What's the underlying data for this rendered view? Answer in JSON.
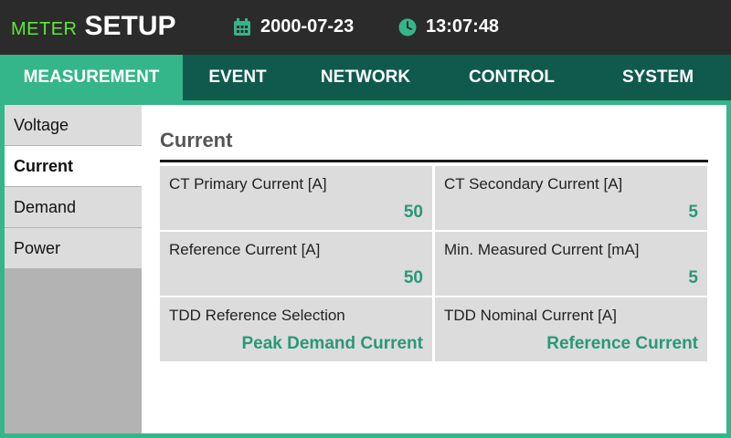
{
  "header": {
    "brand_prefix": "METER",
    "brand_title": "SETUP",
    "date": "2000-07-23",
    "time": "13:07:48",
    "date_icon": "calendar-icon",
    "time_icon": "clock-icon"
  },
  "tabs": [
    {
      "label": "MEASUREMENT",
      "active": true
    },
    {
      "label": "EVENT",
      "active": false
    },
    {
      "label": "NETWORK",
      "active": false
    },
    {
      "label": "CONTROL",
      "active": false
    },
    {
      "label": "SYSTEM",
      "active": false
    }
  ],
  "sidebar": {
    "items": [
      {
        "label": "Voltage",
        "active": false
      },
      {
        "label": "Current",
        "active": true
      },
      {
        "label": "Demand",
        "active": false
      },
      {
        "label": "Power",
        "active": false
      }
    ]
  },
  "main": {
    "title": "Current",
    "fields": [
      {
        "label": "CT Primary Current [A]",
        "value": "50"
      },
      {
        "label": "CT Secondary Current [A]",
        "value": "5"
      },
      {
        "label": "Reference Current [A]",
        "value": "50"
      },
      {
        "label": "Min. Measured Current [mA]",
        "value": "5"
      },
      {
        "label": "TDD Reference Selection",
        "value": "Peak Demand Current"
      },
      {
        "label": "TDD Nominal Current [A]",
        "value": "Reference Current"
      }
    ]
  },
  "colors": {
    "accent": "#35b58a",
    "tab_bar": "#0f5a4d",
    "header_bg": "#2b2b2b",
    "brand_green": "#5ee83a",
    "value_text": "#2a9878"
  }
}
